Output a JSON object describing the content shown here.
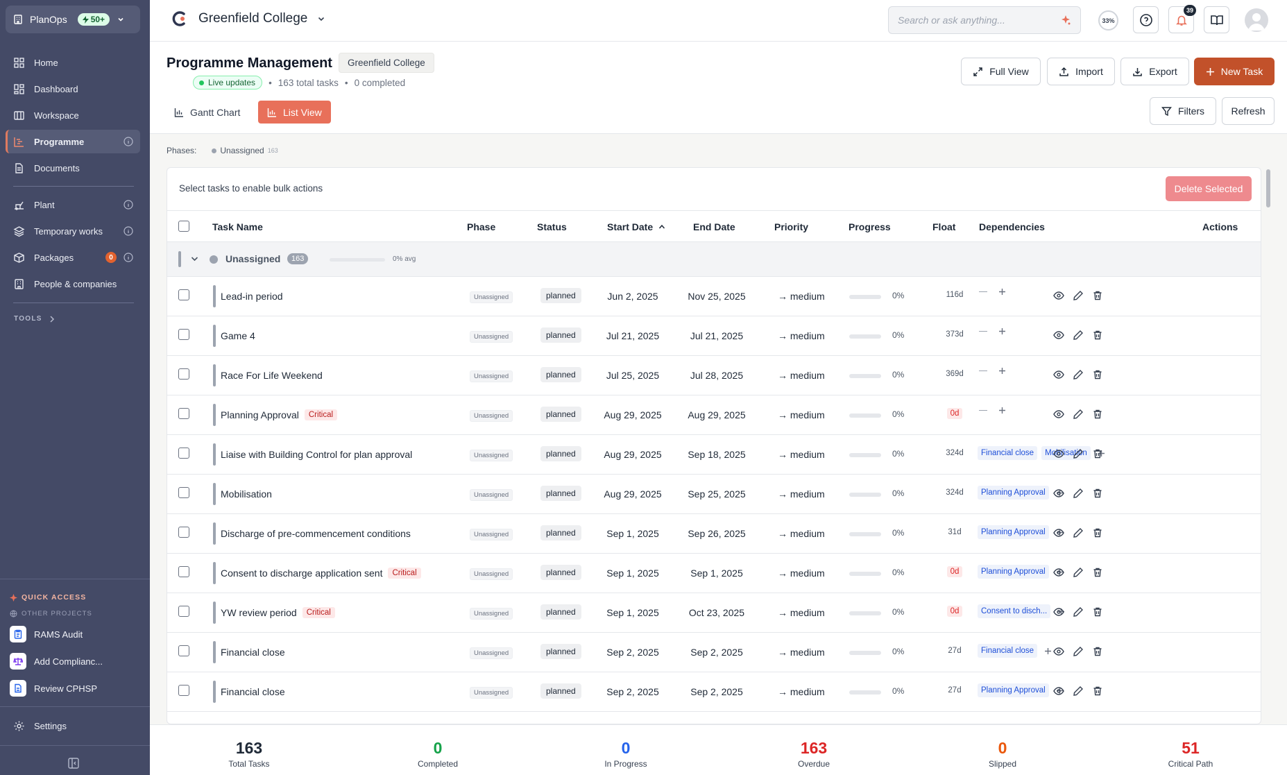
{
  "sidebar": {
    "brand": "PlanOps",
    "brand_badge": "50+",
    "nav": [
      {
        "label": "Home"
      },
      {
        "label": "Dashboard"
      },
      {
        "label": "Workspace"
      },
      {
        "label": "Programme"
      },
      {
        "label": "Documents"
      },
      {
        "label": "Plant"
      },
      {
        "label": "Temporary works"
      },
      {
        "label": "Packages",
        "badge": "0"
      },
      {
        "label": "People & companies"
      }
    ],
    "tools_label": "TOOLS",
    "quick_access_label": "QUICK ACCESS",
    "other_projects_label": "OTHER PROJECTS",
    "quick_items": [
      {
        "label": "RAMS Audit"
      },
      {
        "label": "Add Complianc..."
      },
      {
        "label": "Review CPHSP"
      }
    ],
    "settings_label": "Settings"
  },
  "topbar": {
    "project_name": "Greenfield College",
    "search_placeholder": "Search or ask anything...",
    "progress_circle": "33%",
    "notifications_count": "39"
  },
  "header": {
    "title": "Programme Management",
    "project_tag": "Greenfield College",
    "live_label": "Live updates",
    "total_tasks": "163 total tasks",
    "completed": "0 completed",
    "buttons": {
      "full_view": "Full View",
      "import": "Import",
      "export": "Export",
      "new_task": "New Task",
      "filters": "Filters",
      "refresh": "Refresh"
    },
    "tabs": {
      "gantt": "Gantt Chart",
      "list": "List View"
    }
  },
  "phases_bar": {
    "label": "Phases:",
    "phase_name": "Unassigned",
    "phase_count": "163"
  },
  "table": {
    "bulk_text": "Select tasks to enable bulk actions",
    "delete_label": "Delete Selected",
    "headers": {
      "task": "Task Name",
      "phase": "Phase",
      "status": "Status",
      "start": "Start Date",
      "end": "End Date",
      "priority": "Priority",
      "progress": "Progress",
      "float": "Float",
      "deps": "Dependencies",
      "actions": "Actions"
    },
    "group": {
      "name": "Unassigned",
      "count": "163",
      "avg": "0% avg",
      "progress": 0
    },
    "rows": [
      {
        "name": "Lead-in period",
        "critical": "",
        "phase": "Unassigned",
        "status": "planned",
        "start": "Jun 2, 2025",
        "end": "Nov 25, 2025",
        "priority": "→ medium",
        "progress": "0%",
        "float": "116d",
        "deps": []
      },
      {
        "name": "Game 4",
        "critical": "",
        "phase": "Unassigned",
        "status": "planned",
        "start": "Jul 21, 2025",
        "end": "Jul 21, 2025",
        "priority": "→ medium",
        "progress": "0%",
        "float": "373d",
        "deps": []
      },
      {
        "name": "Race For Life Weekend",
        "critical": "",
        "phase": "Unassigned",
        "status": "planned",
        "start": "Jul 25, 2025",
        "end": "Jul 28, 2025",
        "priority": "→ medium",
        "progress": "0%",
        "float": "369d",
        "deps": []
      },
      {
        "name": "Planning Approval",
        "critical": "Critical",
        "phase": "Unassigned",
        "status": "planned",
        "start": "Aug 29, 2025",
        "end": "Aug 29, 2025",
        "priority": "→ medium",
        "progress": "0%",
        "float": "0d",
        "deps": []
      },
      {
        "name": "Liaise with Building Control for plan approval",
        "critical": "",
        "phase": "Unassigned",
        "status": "planned",
        "start": "Aug 29, 2025",
        "end": "Sep 18, 2025",
        "priority": "→ medium",
        "progress": "0%",
        "float": "324d",
        "deps": [
          "Financial close",
          "Mobilisation"
        ]
      },
      {
        "name": "Mobilisation",
        "critical": "",
        "phase": "Unassigned",
        "status": "planned",
        "start": "Aug 29, 2025",
        "end": "Sep 25, 2025",
        "priority": "→ medium",
        "progress": "0%",
        "float": "324d",
        "deps": [
          "Planning Approval"
        ]
      },
      {
        "name": "Discharge of pre-commencement conditions",
        "critical": "",
        "phase": "Unassigned",
        "status": "planned",
        "start": "Sep 1, 2025",
        "end": "Sep 26, 2025",
        "priority": "→ medium",
        "progress": "0%",
        "float": "31d",
        "deps": [
          "Planning Approval"
        ]
      },
      {
        "name": "Consent to discharge application sent",
        "critical": "Critical",
        "phase": "Unassigned",
        "status": "planned",
        "start": "Sep 1, 2025",
        "end": "Sep 1, 2025",
        "priority": "→ medium",
        "progress": "0%",
        "float": "0d",
        "deps": [
          "Planning Approval"
        ]
      },
      {
        "name": "YW review period",
        "critical": "Critical",
        "phase": "Unassigned",
        "status": "planned",
        "start": "Sep 1, 2025",
        "end": "Oct 23, 2025",
        "priority": "→ medium",
        "progress": "0%",
        "float": "0d",
        "deps": [
          "Consent to disch..."
        ]
      },
      {
        "name": "Financial close",
        "critical": "",
        "phase": "Unassigned",
        "status": "planned",
        "start": "Sep 2, 2025",
        "end": "Sep 2, 2025",
        "priority": "→ medium",
        "progress": "0%",
        "float": "27d",
        "deps": [
          "Financial close"
        ]
      },
      {
        "name": "Financial close",
        "critical": "",
        "phase": "Unassigned",
        "status": "planned",
        "start": "Sep 2, 2025",
        "end": "Sep 2, 2025",
        "priority": "→ medium",
        "progress": "0%",
        "float": "27d",
        "deps": [
          "Planning Approval"
        ]
      }
    ]
  },
  "stats": [
    {
      "value": "163",
      "label": "Total Tasks",
      "color": "#1f2937"
    },
    {
      "value": "0",
      "label": "Completed",
      "color": "#16a34a"
    },
    {
      "value": "0",
      "label": "In Progress",
      "color": "#2563eb"
    },
    {
      "value": "163",
      "label": "Overdue",
      "color": "#dc2626"
    },
    {
      "value": "0",
      "label": "Slipped",
      "color": "#ea580c"
    },
    {
      "value": "51",
      "label": "Critical Path",
      "color": "#dc2626"
    }
  ],
  "colors": {
    "accent": "#c2512a",
    "tab_active": "#e8705a",
    "sidebar": "#444a66"
  }
}
